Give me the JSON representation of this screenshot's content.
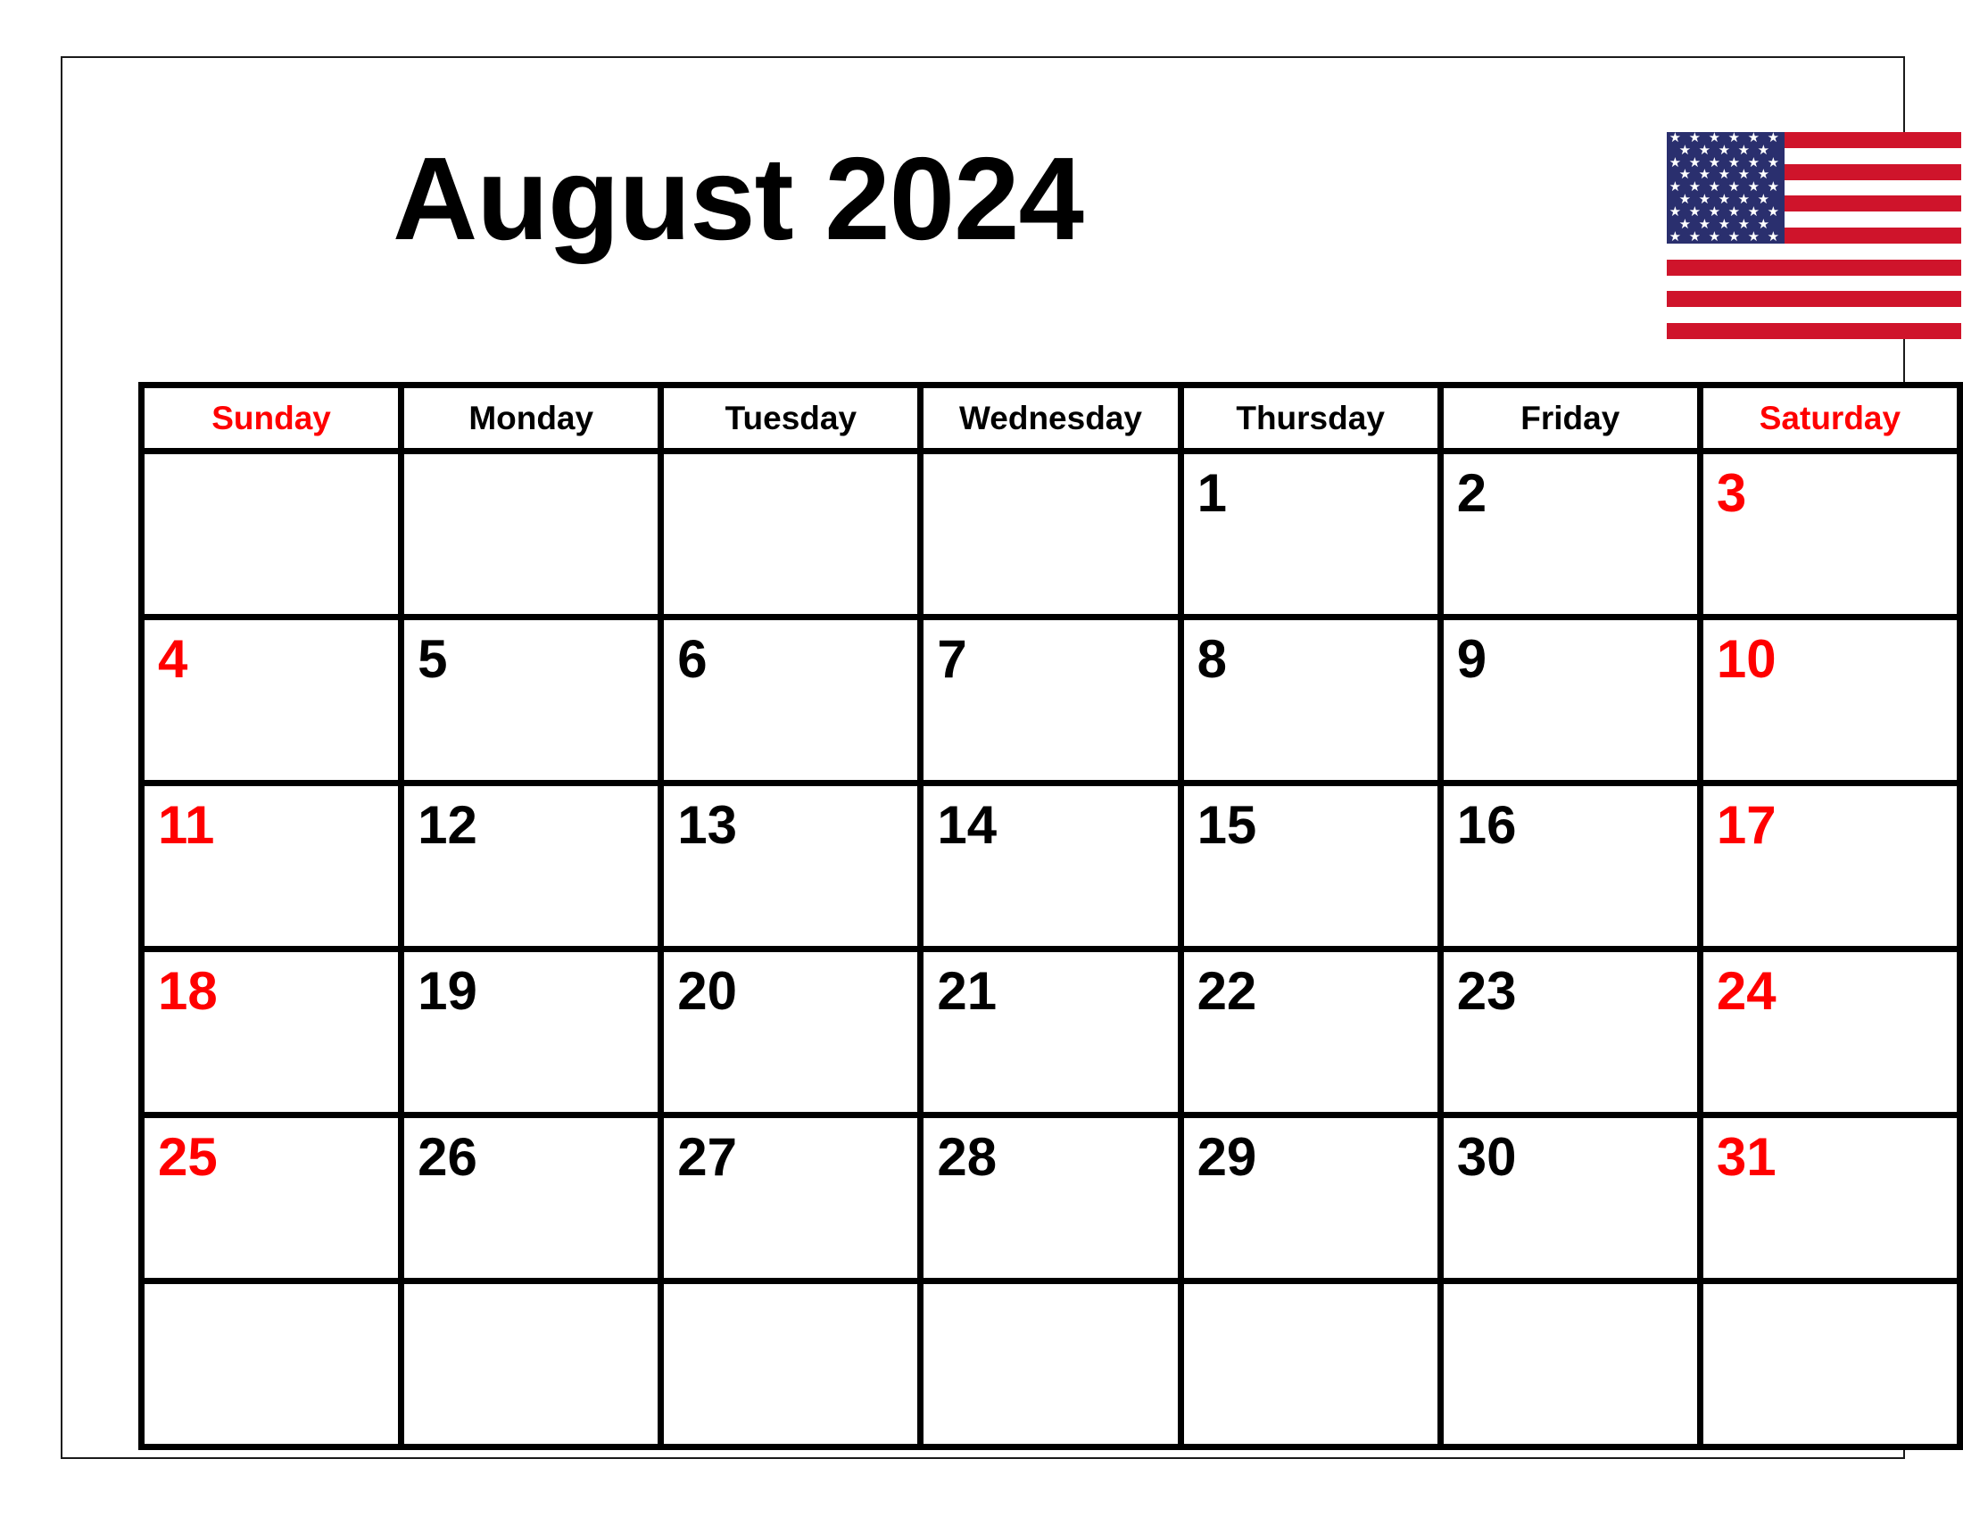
{
  "page": {
    "title": "August 2024",
    "month": "August",
    "year": "2024",
    "colors": {
      "weekend_text": "#ff0000",
      "weekday_text": "#000000",
      "grid_line": "#000000",
      "page_background": "#ffffff",
      "flag_red": "#cf142b",
      "flag_blue": "#2a2f6e",
      "flag_white": "#ffffff"
    }
  },
  "flag": {
    "name": "united-states-flag",
    "stripe_count": 13,
    "star_count": 50
  },
  "calendar": {
    "headers": [
      {
        "label": "Sunday",
        "weekend": true
      },
      {
        "label": "Monday",
        "weekend": false
      },
      {
        "label": "Tuesday",
        "weekend": false
      },
      {
        "label": "Wednesday",
        "weekend": false
      },
      {
        "label": "Thursday",
        "weekend": false
      },
      {
        "label": "Friday",
        "weekend": false
      },
      {
        "label": "Saturday",
        "weekend": true
      }
    ],
    "weeks": [
      [
        {
          "day": "",
          "weekend": true
        },
        {
          "day": "",
          "weekend": false
        },
        {
          "day": "",
          "weekend": false
        },
        {
          "day": "",
          "weekend": false
        },
        {
          "day": "1",
          "weekend": false
        },
        {
          "day": "2",
          "weekend": false
        },
        {
          "day": "3",
          "weekend": true
        }
      ],
      [
        {
          "day": "4",
          "weekend": true
        },
        {
          "day": "5",
          "weekend": false
        },
        {
          "day": "6",
          "weekend": false
        },
        {
          "day": "7",
          "weekend": false
        },
        {
          "day": "8",
          "weekend": false
        },
        {
          "day": "9",
          "weekend": false
        },
        {
          "day": "10",
          "weekend": true
        }
      ],
      [
        {
          "day": "11",
          "weekend": true
        },
        {
          "day": "12",
          "weekend": false
        },
        {
          "day": "13",
          "weekend": false
        },
        {
          "day": "14",
          "weekend": false
        },
        {
          "day": "15",
          "weekend": false
        },
        {
          "day": "16",
          "weekend": false
        },
        {
          "day": "17",
          "weekend": true
        }
      ],
      [
        {
          "day": "18",
          "weekend": true
        },
        {
          "day": "19",
          "weekend": false
        },
        {
          "day": "20",
          "weekend": false
        },
        {
          "day": "21",
          "weekend": false
        },
        {
          "day": "22",
          "weekend": false
        },
        {
          "day": "23",
          "weekend": false
        },
        {
          "day": "24",
          "weekend": true
        }
      ],
      [
        {
          "day": "25",
          "weekend": true
        },
        {
          "day": "26",
          "weekend": false
        },
        {
          "day": "27",
          "weekend": false
        },
        {
          "day": "28",
          "weekend": false
        },
        {
          "day": "29",
          "weekend": false
        },
        {
          "day": "30",
          "weekend": false
        },
        {
          "day": "31",
          "weekend": true
        }
      ],
      [
        {
          "day": "",
          "weekend": true
        },
        {
          "day": "",
          "weekend": false
        },
        {
          "day": "",
          "weekend": false
        },
        {
          "day": "",
          "weekend": false
        },
        {
          "day": "",
          "weekend": false
        },
        {
          "day": "",
          "weekend": false
        },
        {
          "day": "",
          "weekend": true
        }
      ]
    ]
  }
}
